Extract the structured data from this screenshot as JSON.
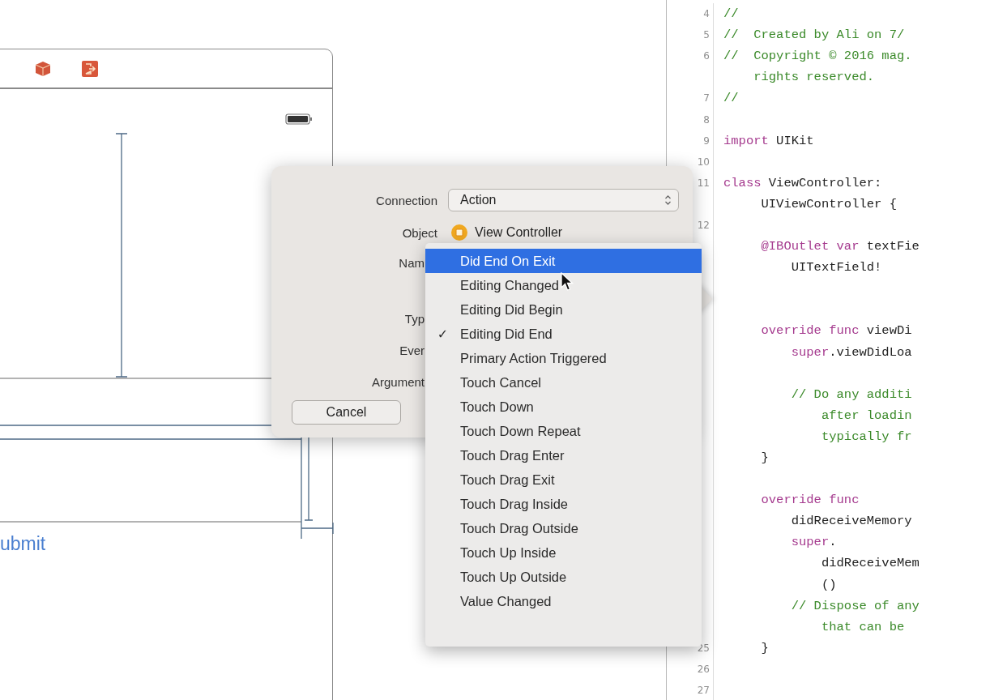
{
  "storyboard": {
    "button_label": "ubmit"
  },
  "connection_popover": {
    "fields": [
      {
        "label": "Connection",
        "kind": "popup",
        "value": "Action"
      },
      {
        "label": "Object",
        "kind": "object",
        "value": "View Controller"
      },
      {
        "label": "Nam",
        "kind": "covered"
      },
      {
        "label": "Typ",
        "kind": "covered"
      },
      {
        "label": "Ever",
        "kind": "covered"
      },
      {
        "label": "Argument",
        "kind": "covered"
      }
    ],
    "cancel_button": "Cancel"
  },
  "event_menu": {
    "items": [
      {
        "label": "Did End On Exit",
        "checked": false,
        "selected": true
      },
      {
        "label": "Editing Changed",
        "checked": false,
        "selected": false
      },
      {
        "label": "Editing Did Begin",
        "checked": false,
        "selected": false
      },
      {
        "label": "Editing Did End",
        "checked": true,
        "selected": false
      },
      {
        "label": "Primary Action Triggered",
        "checked": false,
        "selected": false
      },
      {
        "label": "Touch Cancel",
        "checked": false,
        "selected": false
      },
      {
        "label": "Touch Down",
        "checked": false,
        "selected": false
      },
      {
        "label": "Touch Down Repeat",
        "checked": false,
        "selected": false
      },
      {
        "label": "Touch Drag Enter",
        "checked": false,
        "selected": false
      },
      {
        "label": "Touch Drag Exit",
        "checked": false,
        "selected": false
      },
      {
        "label": "Touch Drag Inside",
        "checked": false,
        "selected": false
      },
      {
        "label": "Touch Drag Outside",
        "checked": false,
        "selected": false
      },
      {
        "label": "Touch Up Inside",
        "checked": false,
        "selected": false
      },
      {
        "label": "Touch Up Outside",
        "checked": false,
        "selected": false
      },
      {
        "label": "Value Changed",
        "checked": false,
        "selected": false
      }
    ],
    "check_mark": "✓"
  },
  "code_editor": {
    "lines": [
      {
        "kind": "code",
        "number": "4",
        "segments": [
          {
            "kind": "comment",
            "text": "//"
          }
        ]
      },
      {
        "kind": "code",
        "number": "5",
        "segments": [
          {
            "kind": "comment",
            "text": "//  Created by Ali on 7/"
          }
        ]
      },
      {
        "kind": "code",
        "number": "6",
        "segments": [
          {
            "kind": "comment",
            "text": "//  Copyright © 2016 mag."
          }
        ]
      },
      {
        "kind": "code",
        "segments": [
          {
            "kind": "comment",
            "text": "    rights reserved."
          }
        ]
      },
      {
        "kind": "code",
        "number": "7",
        "segments": [
          {
            "kind": "comment",
            "text": "//"
          }
        ]
      },
      {
        "kind": "blank",
        "number": "8"
      },
      {
        "kind": "code",
        "number": "9",
        "segments": [
          {
            "kind": "keyword",
            "text": "import"
          },
          {
            "kind": "plain",
            "text": " UIKit"
          }
        ]
      },
      {
        "kind": "blank",
        "number": "10"
      },
      {
        "kind": "code",
        "number": "11",
        "segments": [
          {
            "kind": "keyword",
            "text": "class"
          },
          {
            "kind": "plain",
            "text": " ViewController:"
          }
        ]
      },
      {
        "kind": "code",
        "segments": [
          {
            "kind": "plain",
            "text": "     UIViewController {"
          }
        ]
      },
      {
        "kind": "blank",
        "number": "12"
      },
      {
        "kind": "code",
        "segments": [
          {
            "kind": "keyword",
            "text": "     @IBOutlet var"
          },
          {
            "kind": "plain",
            "text": " textFie"
          }
        ]
      },
      {
        "kind": "code",
        "segments": [
          {
            "kind": "plain",
            "text": "         UITextField!"
          }
        ]
      },
      {
        "kind": "blank"
      },
      {
        "kind": "blank"
      },
      {
        "kind": "code",
        "segments": [
          {
            "kind": "keyword",
            "text": "     override func"
          },
          {
            "kind": "plain",
            "text": " viewDi"
          }
        ]
      },
      {
        "kind": "code",
        "segments": [
          {
            "kind": "keyword",
            "text": "         super"
          },
          {
            "kind": "plain",
            "text": ".viewDidLoa"
          }
        ]
      },
      {
        "kind": "blank"
      },
      {
        "kind": "code",
        "segments": [
          {
            "kind": "comment",
            "text": "         // Do any additi"
          }
        ]
      },
      {
        "kind": "code",
        "segments": [
          {
            "kind": "comment",
            "text": "             after loadin"
          }
        ]
      },
      {
        "kind": "code",
        "segments": [
          {
            "kind": "comment",
            "text": "             typically fr"
          }
        ]
      },
      {
        "kind": "code",
        "segments": [
          {
            "kind": "plain",
            "text": "     }"
          }
        ]
      },
      {
        "kind": "blank"
      },
      {
        "kind": "code",
        "segments": [
          {
            "kind": "keyword",
            "text": "     override func"
          }
        ]
      },
      {
        "kind": "code",
        "segments": [
          {
            "kind": "plain",
            "text": "         didReceiveMemory"
          }
        ]
      },
      {
        "kind": "code",
        "segments": [
          {
            "kind": "keyword",
            "text": "         super"
          },
          {
            "kind": "plain",
            "text": "."
          }
        ]
      },
      {
        "kind": "code",
        "segments": [
          {
            "kind": "plain",
            "text": "             didReceiveMem"
          }
        ]
      },
      {
        "kind": "code",
        "segments": [
          {
            "kind": "plain",
            "text": "             ()"
          }
        ]
      },
      {
        "kind": "code",
        "segments": [
          {
            "kind": "comment",
            "text": "         // Dispose of any"
          }
        ]
      },
      {
        "kind": "code",
        "segments": [
          {
            "kind": "comment",
            "text": "             that can be"
          }
        ]
      },
      {
        "kind": "code",
        "number": "25",
        "segments": [
          {
            "kind": "plain",
            "text": "     }"
          }
        ]
      },
      {
        "kind": "blank",
        "number": "26"
      },
      {
        "kind": "blank",
        "number": "27"
      }
    ]
  }
}
